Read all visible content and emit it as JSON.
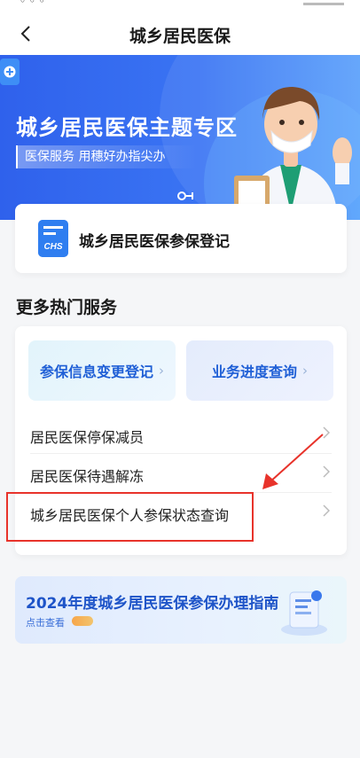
{
  "nav": {
    "title": "城乡居民医保",
    "back_icon": "chevron-left-icon"
  },
  "banner": {
    "title": "城乡居民医保主题专区",
    "subtitle": "医保服务 用穗好办指尖办"
  },
  "register": {
    "icon": "chs-card-icon",
    "icon_text": "CHS",
    "label": "城乡居民医保参保登记"
  },
  "more": {
    "title": "更多热门服务",
    "tiles": [
      {
        "label": "参保信息变更登记"
      },
      {
        "label": "业务进度查询"
      }
    ],
    "rows": [
      {
        "label": "居民医保停保减员"
      },
      {
        "label": "居民医保待遇解冻"
      },
      {
        "label": "城乡居民医保个人参保状态查询"
      }
    ]
  },
  "guide": {
    "title": "2024年度城乡居民医保参保办理指南",
    "cta": "点击查看"
  },
  "colors": {
    "brand_blue": "#2f61ec",
    "annotation_red": "#e8332b"
  }
}
